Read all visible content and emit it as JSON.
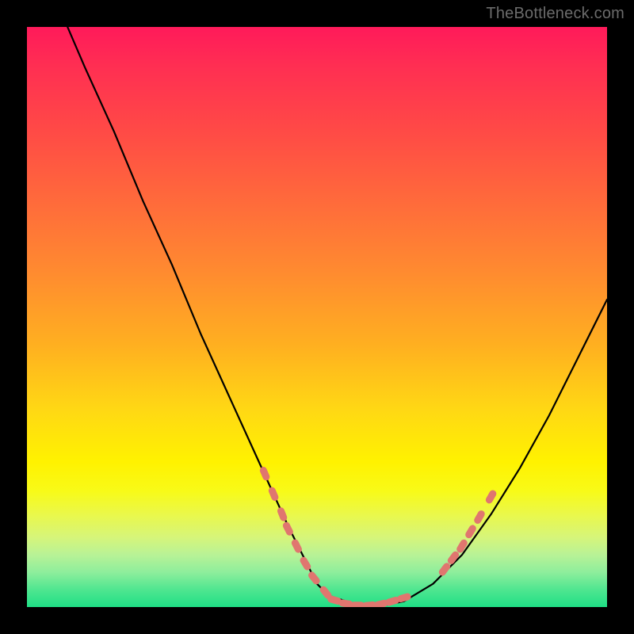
{
  "watermark": {
    "text": "TheBottleneck.com"
  },
  "chart_data": {
    "type": "line",
    "title": "",
    "xlabel": "",
    "ylabel": "",
    "xlim": [
      0,
      100
    ],
    "ylim": [
      0,
      100
    ],
    "grid": false,
    "legend": false,
    "series": [
      {
        "name": "bottleneck-curve",
        "x": [
          7,
          10,
          15,
          20,
          25,
          30,
          35,
          40,
          45,
          48,
          50,
          52,
          55,
          58,
          60,
          65,
          70,
          75,
          80,
          85,
          90,
          95,
          100
        ],
        "y": [
          100,
          93,
          82,
          70,
          59,
          47,
          36,
          25,
          14,
          8,
          4,
          2,
          1,
          0,
          0,
          1,
          4,
          9,
          16,
          24,
          33,
          43,
          53
        ]
      }
    ],
    "markers": [
      {
        "name": "highlight-dots-left",
        "shape": "rounded-rect",
        "color": "#e0766f",
        "points": [
          {
            "x": 41.0,
            "y": 23.0
          },
          {
            "x": 42.5,
            "y": 19.5
          },
          {
            "x": 44.0,
            "y": 16.0
          },
          {
            "x": 45.0,
            "y": 13.5
          },
          {
            "x": 46.5,
            "y": 10.5
          },
          {
            "x": 48.0,
            "y": 7.5
          },
          {
            "x": 49.5,
            "y": 5.0
          },
          {
            "x": 51.5,
            "y": 2.5
          }
        ]
      },
      {
        "name": "highlight-dots-bottom",
        "shape": "rounded-rect",
        "color": "#e0766f",
        "points": [
          {
            "x": 53.0,
            "y": 1.2
          },
          {
            "x": 55.0,
            "y": 0.6
          },
          {
            "x": 57.0,
            "y": 0.3
          },
          {
            "x": 59.0,
            "y": 0.3
          },
          {
            "x": 61.0,
            "y": 0.5
          },
          {
            "x": 63.0,
            "y": 1.0
          },
          {
            "x": 65.0,
            "y": 1.6
          }
        ]
      },
      {
        "name": "highlight-dots-right",
        "shape": "rounded-rect",
        "color": "#e0766f",
        "points": [
          {
            "x": 72.0,
            "y": 6.5
          },
          {
            "x": 73.5,
            "y": 8.5
          },
          {
            "x": 75.0,
            "y": 10.5
          },
          {
            "x": 76.5,
            "y": 13.0
          },
          {
            "x": 78.0,
            "y": 15.5
          },
          {
            "x": 80.0,
            "y": 19.0
          }
        ]
      }
    ],
    "background_bands": [
      {
        "y": 75,
        "color": "#fff200"
      },
      {
        "y": 0,
        "color": "#1fdf85"
      }
    ]
  }
}
